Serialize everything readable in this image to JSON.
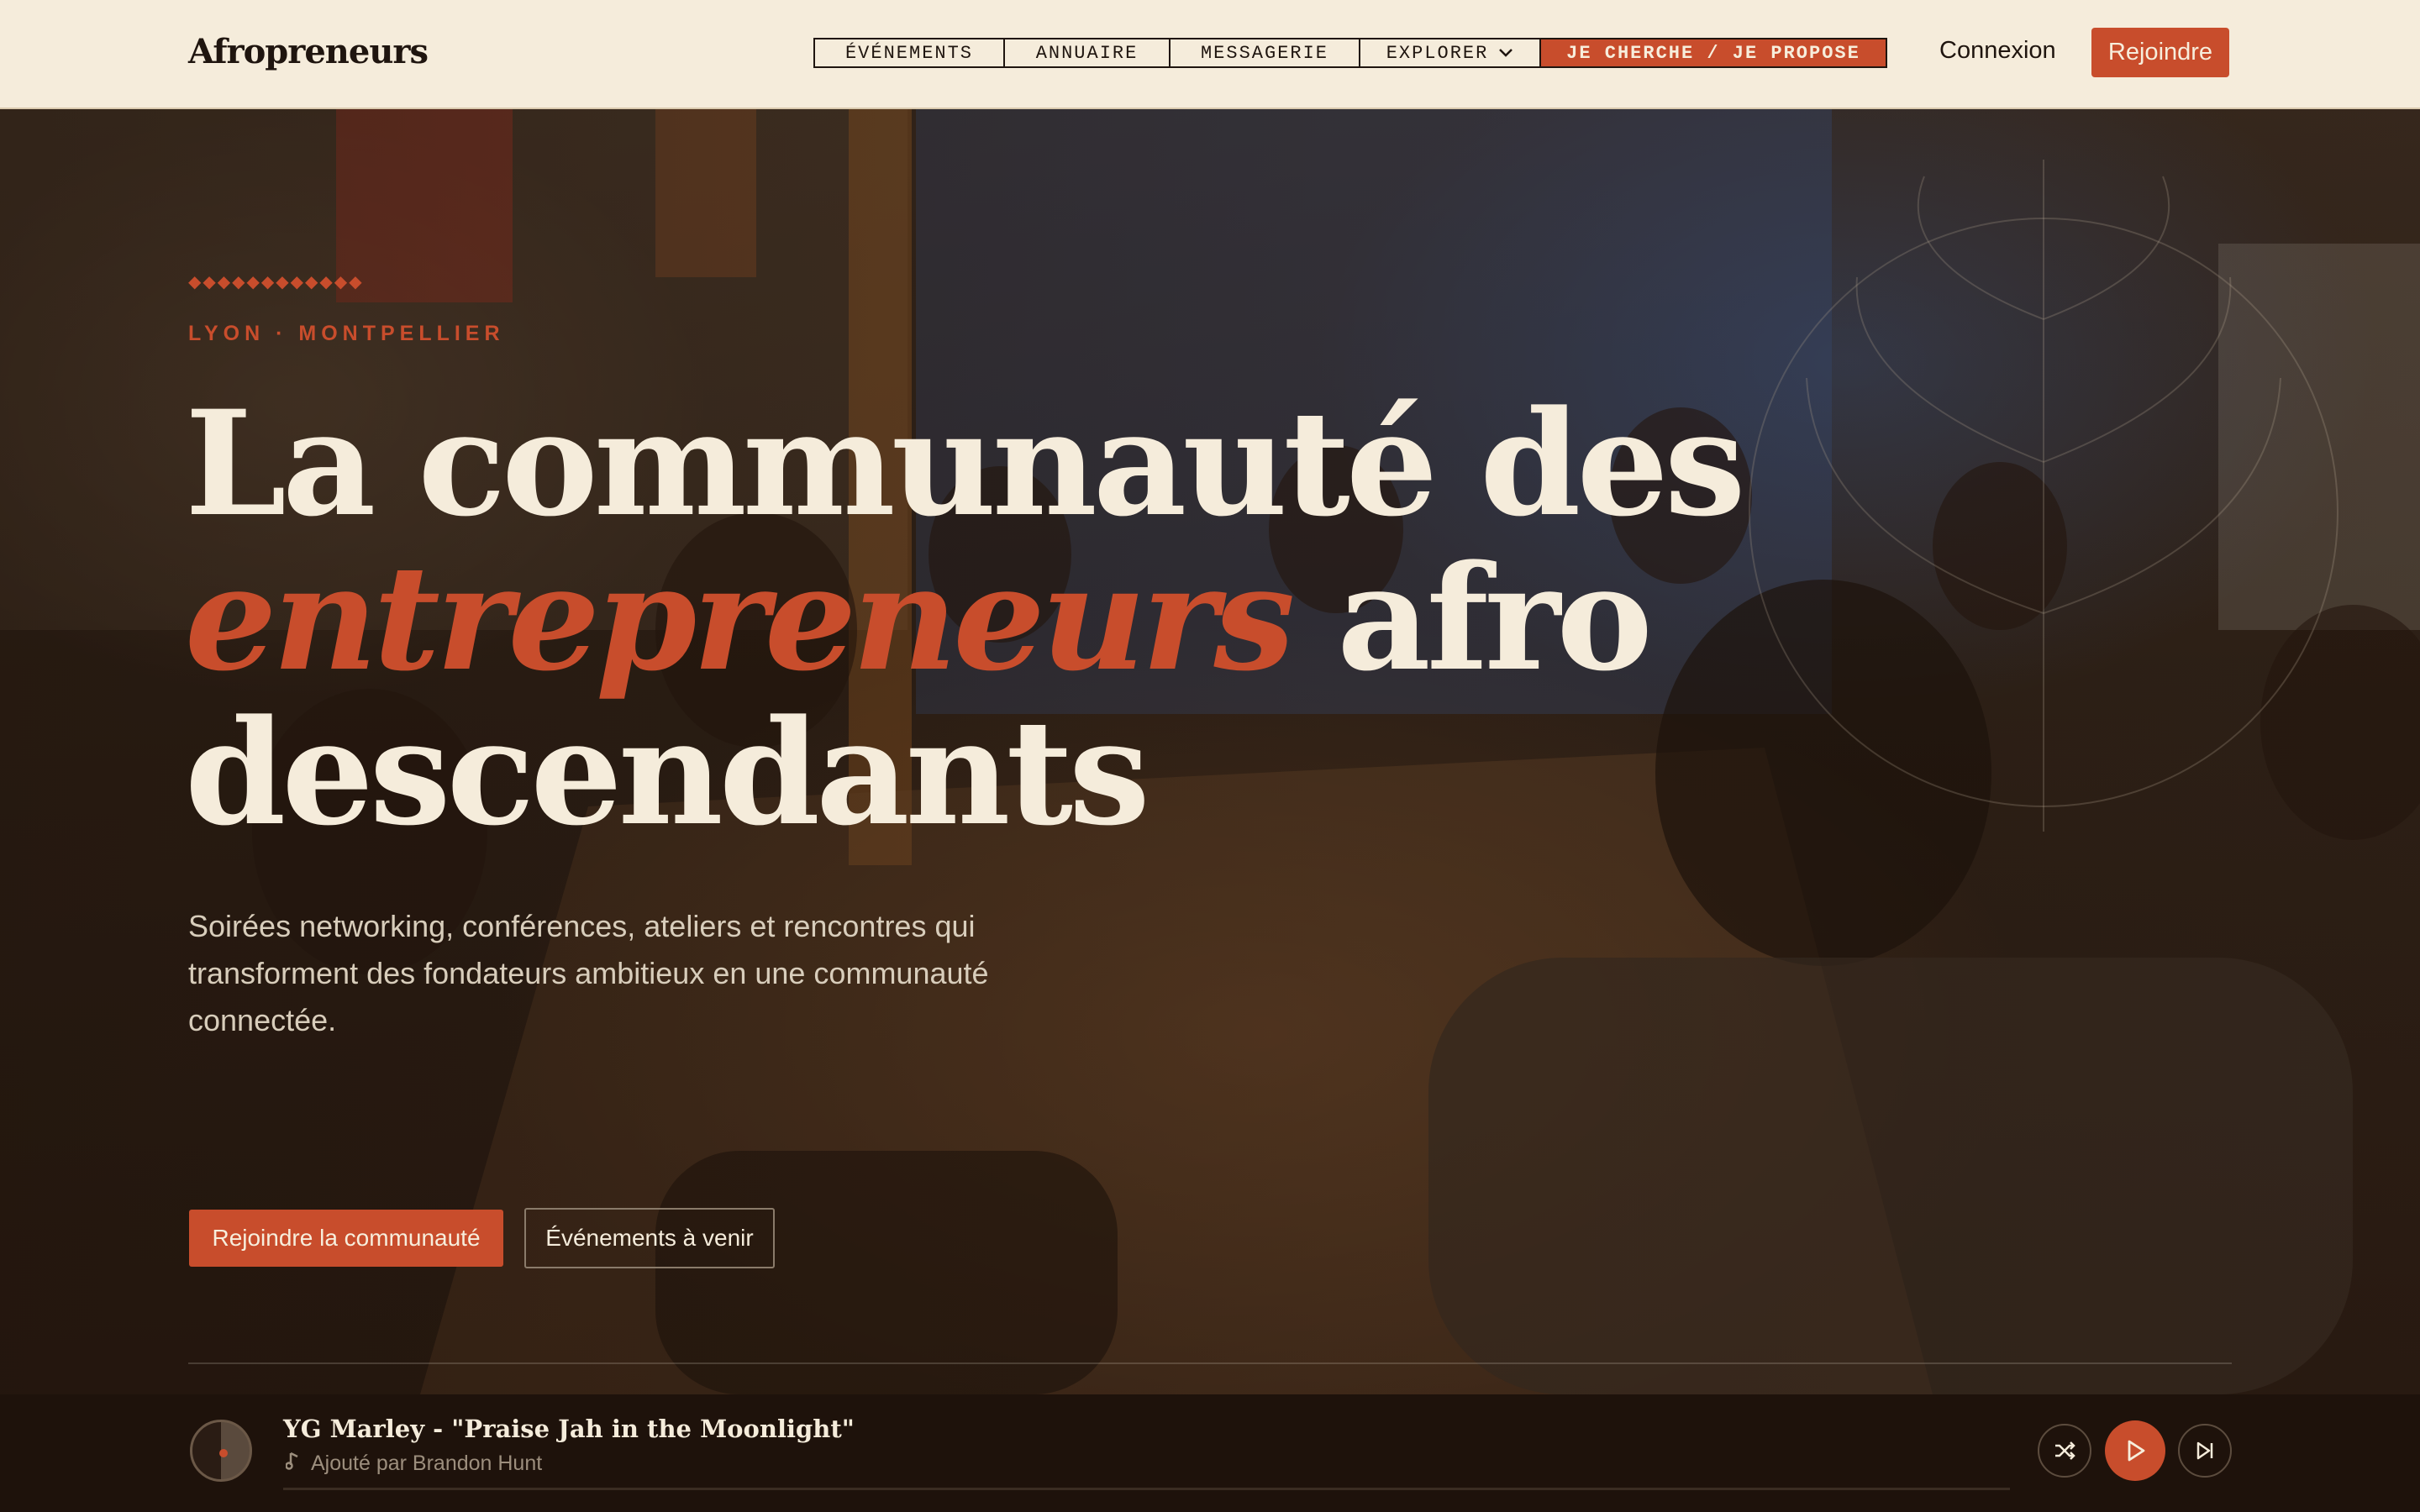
{
  "header": {
    "brand": "Afropreneurs",
    "nav": [
      "ÉVÉNEMENTS",
      "ANNUAIRE",
      "MESSAGERIE",
      "EXPLORER"
    ],
    "nav_cta": "JE CHERCHE / JE PROPOSE",
    "login": "Connexion",
    "join": "Rejoindre"
  },
  "hero": {
    "eyebrow": "LYON · MONTPELLIER",
    "headline_line1": "La communauté des",
    "headline_accent": "entrepreneurs",
    "headline_line2_rest": " afro",
    "headline_line3": "descendants",
    "lede": "Soirées networking, conférences, ateliers et rencontres qui transforment des fondateurs ambitieux en une communauté connectée.",
    "cta_primary": "Rejoindre la communauté",
    "cta_secondary": "Événements à venir"
  },
  "player": {
    "title": "YG Marley - \"Praise Jah in the Moonlight\"",
    "added_by": "Ajouté par Brandon Hunt",
    "progress_fraction": 0.0
  },
  "colors": {
    "accent": "#c84d2c",
    "cream": "#f5ecdb",
    "dark": "#1e120b"
  }
}
